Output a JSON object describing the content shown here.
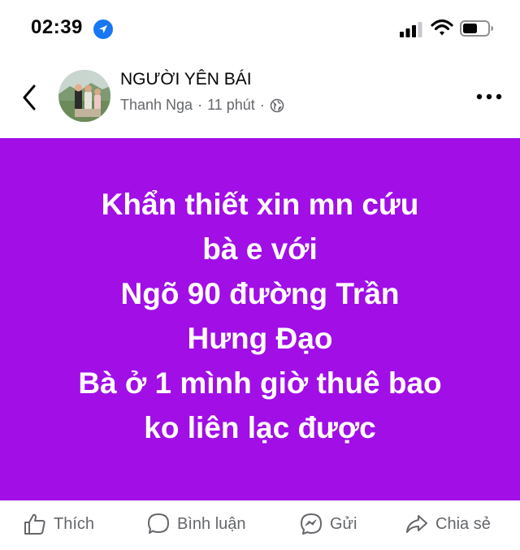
{
  "status_bar": {
    "time": "02:39"
  },
  "header": {
    "group_name": "NGƯỜI YÊN BÁI",
    "author": "Thanh Nga",
    "separator": "·",
    "time_ago": "11 phút",
    "separator2": "·"
  },
  "post": {
    "background_color": "#a10ee6",
    "text_color": "#ffffff",
    "lines": [
      "Khẩn thiết xin mn cứu",
      "bà e với",
      "Ngõ 90 đường Trần",
      "Hưng Đạo",
      "Bà ở 1 mình giờ thuê bao",
      "ko liên lạc được"
    ]
  },
  "actions": {
    "like_label": "Thích",
    "comment_label": "Bình luận",
    "send_label": "Gửi",
    "share_label": "Chia sẻ"
  },
  "icons": {
    "location": "location-arrow-icon",
    "signal": "cellular-signal-icon",
    "wifi": "wifi-icon",
    "battery": "battery-icon",
    "back": "chevron-left-icon",
    "more": "more-horizontal-icon",
    "globe": "globe-icon",
    "like": "thumbs-up-icon",
    "comment": "comment-bubble-icon",
    "send": "messenger-icon",
    "share": "share-arrow-icon"
  }
}
